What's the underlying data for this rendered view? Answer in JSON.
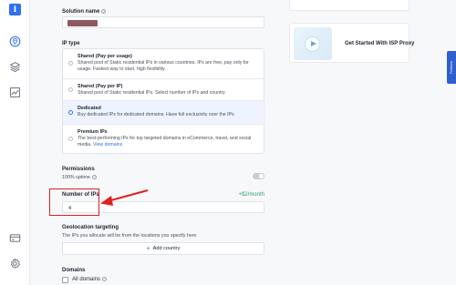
{
  "sidebar": {
    "items": [
      {
        "icon": "info-icon",
        "glyph": "i"
      },
      {
        "icon": "location-pin-icon"
      },
      {
        "icon": "layers-icon"
      },
      {
        "icon": "trend-chart-icon"
      },
      {
        "icon": "billing-card-icon"
      },
      {
        "icon": "settings-gear-icon"
      }
    ]
  },
  "form": {
    "solution_name_label": "Solution name",
    "ip_type_label": "IP type",
    "ip_types": [
      {
        "title": "Shared (Pay per usage)",
        "desc": "Shared pool of Static residential IPs in various countries. IPs are free, pay only for usage. Fastest way to start, high flexibility",
        "selected": false
      },
      {
        "title": "Shared (Pay per IP)",
        "desc": "Shared pool of Static residential IPs. Select number of IPs and country",
        "selected": false
      },
      {
        "title": "Dedicated",
        "desc": "Buy dedicated IPs for dedicated domains. Have full exclusivity over the IPs",
        "selected": true
      },
      {
        "title": "Premium IPs",
        "desc": "The best-performing IPs for top targeted domains in eCommerce, travel, and social media.",
        "link": "View domains",
        "selected": false
      }
    ],
    "permissions_label": "Permissions",
    "uptime_label": "100% uptime",
    "number_of_ips_label": "Number of IPs",
    "number_of_ips_value": "4",
    "price_label": "+$2/month",
    "geo_label": "Geolocation targeting",
    "geo_desc": "The IPs you allocate will be from the locations you specify here",
    "add_country_label": "Add country",
    "domains_label": "Domains",
    "all_domains_label": "All domains"
  },
  "right": {
    "card_title": "Get Started With ISP Proxy",
    "feedback_label": "Feedback"
  },
  "colors": {
    "accent": "#2f6ff0",
    "annotation": "#e02020",
    "price": "#2e9e6e"
  }
}
